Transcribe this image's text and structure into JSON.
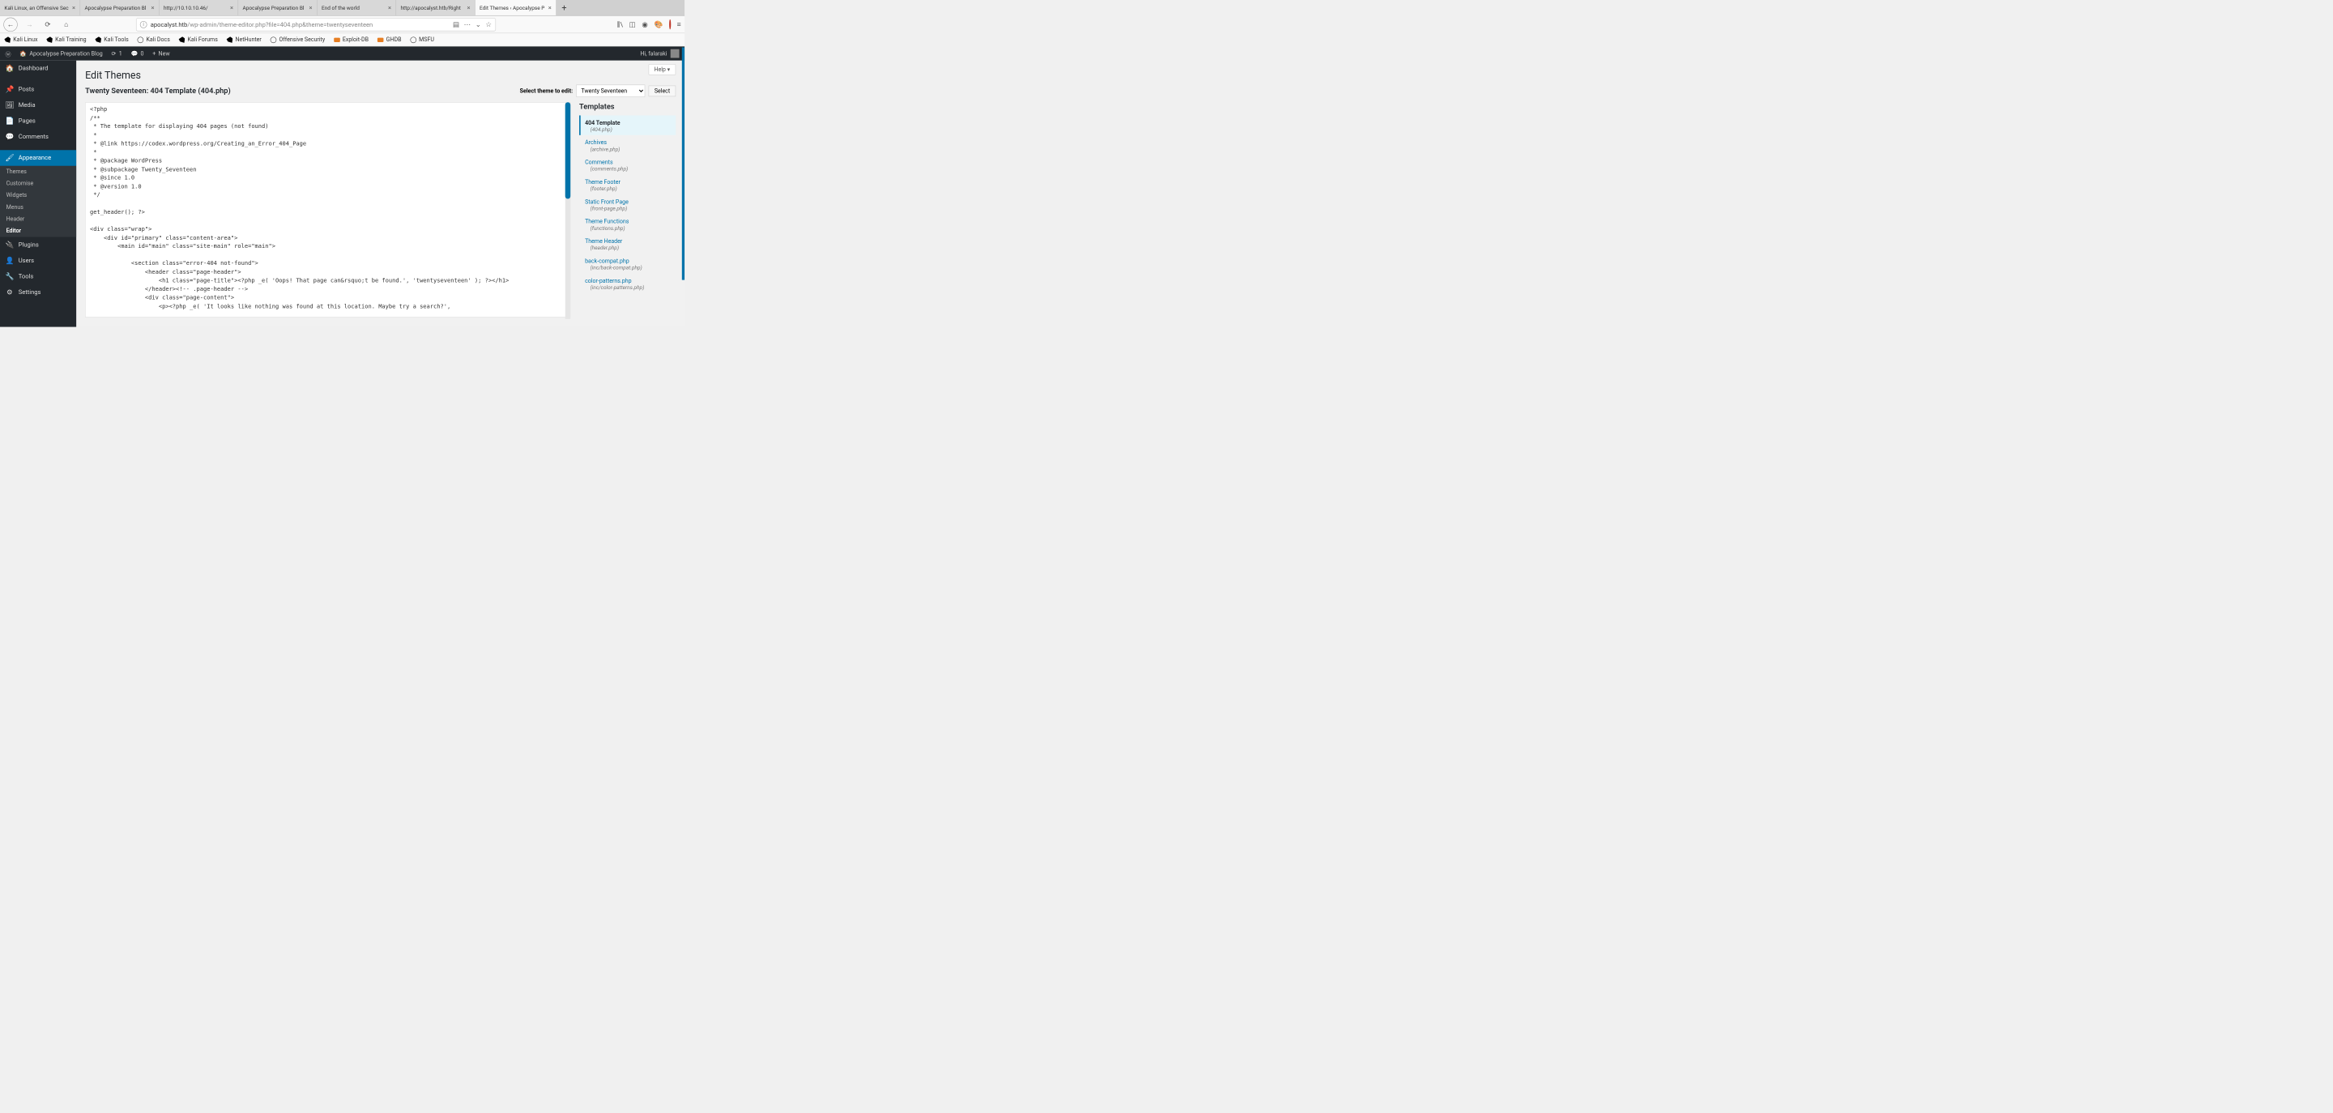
{
  "browser": {
    "tabs": [
      {
        "title": "Kali Linux, an Offensive Sec"
      },
      {
        "title": "Apocalypse Preparation Bl"
      },
      {
        "title": "http://10.10.10.46/"
      },
      {
        "title": "Apocalypse Preparation Bl"
      },
      {
        "title": "End of the world"
      },
      {
        "title": "http://apocalyst.htb/Right"
      },
      {
        "title": "Edit Themes ‹ Apocalypse P",
        "active": true
      }
    ],
    "url_host": "apocalyst.htb",
    "url_rest": "/wp-admin/theme-editor.php?file=404.php&theme=twentyseventeen"
  },
  "bookmarks": [
    {
      "label": "Kali Linux",
      "icon": "kali"
    },
    {
      "label": "Kali Training",
      "icon": "kali"
    },
    {
      "label": "Kali Tools",
      "icon": "kali"
    },
    {
      "label": "Kali Docs",
      "icon": "globe"
    },
    {
      "label": "Kali Forums",
      "icon": "kali"
    },
    {
      "label": "NetHunter",
      "icon": "kali"
    },
    {
      "label": "Offensive Security",
      "icon": "globe"
    },
    {
      "label": "Exploit-DB",
      "icon": "orange"
    },
    {
      "label": "GHDB",
      "icon": "orange"
    },
    {
      "label": "MSFU",
      "icon": "globe"
    }
  ],
  "wpbar": {
    "site": "Apocalypse Preparation Blog",
    "updates": "1",
    "comments": "0",
    "new": "New",
    "greeting": "Hi, falaraki"
  },
  "menu": {
    "dashboard": "Dashboard",
    "posts": "Posts",
    "media": "Media",
    "pages": "Pages",
    "comments": "Comments",
    "appearance": "Appearance",
    "sub": {
      "themes": "Themes",
      "customise": "Customise",
      "widgets": "Widgets",
      "menus": "Menus",
      "header": "Header",
      "editor": "Editor"
    },
    "plugins": "Plugins",
    "users": "Users",
    "tools": "Tools",
    "settings": "Settings"
  },
  "content": {
    "help": "Help ▾",
    "h1": "Edit Themes",
    "editing_label": "Twenty Seventeen: 404 Template (404.php)",
    "select_label": "Select theme to edit:",
    "select_value": "Twenty Seventeen",
    "select_button": "Select",
    "code": "<?php\n/**\n * The template for displaying 404 pages (not found)\n *\n * @link https://codex.wordpress.org/Creating_an_Error_404_Page\n *\n * @package WordPress\n * @subpackage Twenty_Seventeen\n * @since 1.0\n * @version 1.0\n */\n\nget_header(); ?>\n\n<div class=\"wrap\">\n    <div id=\"primary\" class=\"content-area\">\n        <main id=\"main\" class=\"site-main\" role=\"main\">\n\n            <section class=\"error-404 not-found\">\n                <header class=\"page-header\">\n                    <h1 class=\"page-title\"><?php _e( 'Oops! That page can&rsquo;t be found.', 'twentyseventeen' ); ?></h1>\n                </header><!-- .page-header -->\n                <div class=\"page-content\">\n                    <p><?php _e( 'It looks like nothing was found at this location. Maybe try a search?',",
    "templates_heading": "Templates",
    "templates": [
      {
        "name": "404 Template",
        "file": "(404.php)",
        "active": true
      },
      {
        "name": "Archives",
        "file": "(archive.php)"
      },
      {
        "name": "Comments",
        "file": "(comments.php)"
      },
      {
        "name": "Theme Footer",
        "file": "(footer.php)"
      },
      {
        "name": "Static Front Page",
        "file": "(front-page.php)"
      },
      {
        "name": "Theme Functions",
        "file": "(functions.php)"
      },
      {
        "name": "Theme Header",
        "file": "(header.php)"
      },
      {
        "name": "back-compat.php",
        "file": "(inc/back-compat.php)"
      },
      {
        "name": "color-patterns.php",
        "file": "(inc/color-patterns.php)"
      }
    ]
  }
}
